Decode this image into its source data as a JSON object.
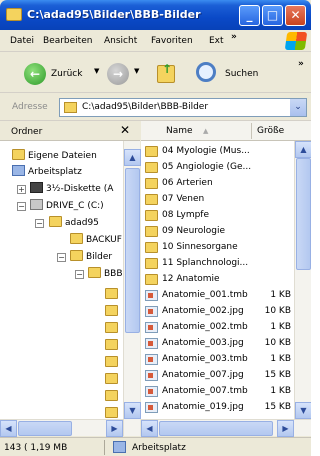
{
  "window": {
    "title": "C:\\adad95\\Bilder\\BBB-Bilder",
    "min_glyph": "_",
    "max_glyph": "□",
    "close_glyph": "✕"
  },
  "menu": {
    "items": [
      "Datei",
      "Bearbeiten",
      "Ansicht",
      "Favoriten",
      "Ext"
    ],
    "more": "»"
  },
  "toolbar": {
    "back_label": "Zurück",
    "search_label": "Suchen",
    "more": "»",
    "dropdown": "▼"
  },
  "address": {
    "label": "Adresse",
    "path": "C:\\adad95\\Bilder\\BBB-Bilder",
    "dropdown": "⌄"
  },
  "folder_pane": {
    "title": "Ordner",
    "close": "✕",
    "items": [
      {
        "label": "Eigene Dateien"
      },
      {
        "label": "Arbeitsplatz"
      },
      {
        "label": "3½-Diskette (A"
      },
      {
        "label": "DRIVE_C (C:)"
      },
      {
        "label": "adad95"
      },
      {
        "label": "BACKUF"
      },
      {
        "label": "Bilder"
      },
      {
        "label": "BBB"
      }
    ]
  },
  "list_pane": {
    "col_name": "Name",
    "sort_glyph": "▲",
    "col_size": "Größe",
    "rows": [
      {
        "name": "04 Myologie (Mus...",
        "size": ""
      },
      {
        "name": "05 Angiologie (Ge...",
        "size": ""
      },
      {
        "name": "06 Arterien",
        "size": ""
      },
      {
        "name": "07 Venen",
        "size": ""
      },
      {
        "name": "08 Lympfe",
        "size": ""
      },
      {
        "name": "09 Neurologie",
        "size": ""
      },
      {
        "name": "10 Sinnesorgane",
        "size": ""
      },
      {
        "name": "11 Splanchnologi...",
        "size": ""
      },
      {
        "name": "12 Anatomie",
        "size": ""
      },
      {
        "name": "Anatomie_001.tmb",
        "size": "1 KB"
      },
      {
        "name": "Anatomie_002.jpg",
        "size": "10 KB"
      },
      {
        "name": "Anatomie_002.tmb",
        "size": "1 KB"
      },
      {
        "name": "Anatomie_003.jpg",
        "size": "10 KB"
      },
      {
        "name": "Anatomie_003.tmb",
        "size": "1 KB"
      },
      {
        "name": "Anatomie_007.jpg",
        "size": "15 KB"
      },
      {
        "name": "Anatomie_007.tmb",
        "size": "1 KB"
      },
      {
        "name": "Anatomie_019.jpg",
        "size": "15 KB"
      }
    ]
  },
  "scroll": {
    "up": "▲",
    "down": "▼",
    "left": "◀",
    "right": "▶"
  },
  "status": {
    "left": "143 ( 1,19 MB",
    "right": "Arbeitsplatz"
  }
}
